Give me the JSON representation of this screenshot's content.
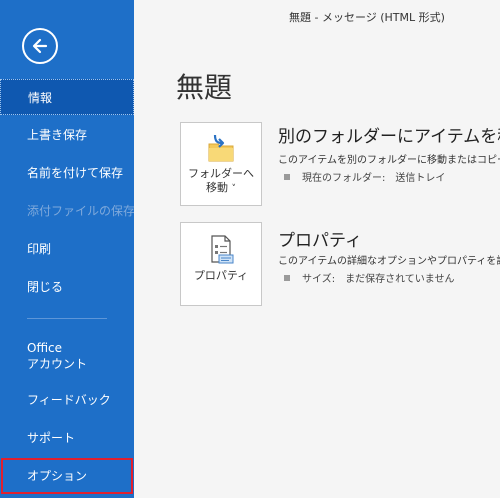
{
  "window_title": "無題 - メッセージ (HTML 形式)",
  "sidebar": {
    "items": [
      {
        "label": "情報"
      },
      {
        "label": "上書き保存"
      },
      {
        "label": "名前を付けて保存"
      },
      {
        "label": "添付ファイルの保存"
      },
      {
        "label": "印刷"
      },
      {
        "label": "閉じる"
      },
      {
        "label_line1": "Office",
        "label_line2": "アカウント"
      },
      {
        "label": "フィードバック"
      },
      {
        "label": "サポート"
      },
      {
        "label": "オプション"
      }
    ]
  },
  "main": {
    "page_title": "無題",
    "move": {
      "tile_line1": "フォルダーへ",
      "tile_line2": "移動",
      "tile_caret": "˅",
      "title": "別のフォルダーにアイテムを移動",
      "description": "このアイテムを別のフォルダーに移動またはコピー",
      "bullet": "現在のフォルダー:　送信トレイ"
    },
    "properties": {
      "tile_label": "プロパティ",
      "title": "プロパティ",
      "description": "このアイテムの詳細なオプションやプロパティを設定",
      "bullet": "サイズ:　まだ保存されていません"
    }
  },
  "colors": {
    "sidebar_bg": "#1e6fc8",
    "sidebar_active": "#0f58b0",
    "highlight_box": "#e0202e",
    "main_bg": "#f5f5f5"
  }
}
